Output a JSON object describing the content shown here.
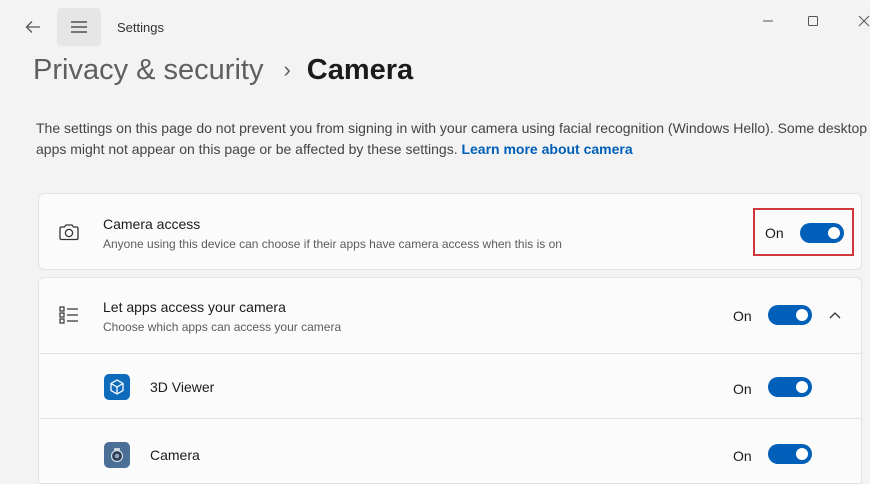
{
  "app": {
    "title": "Settings"
  },
  "breadcrumb": {
    "parent": "Privacy & security",
    "separator": "›",
    "current": "Camera"
  },
  "description": {
    "text": "The settings on this page do not prevent you from signing in with your camera using facial recognition (Windows Hello). Some desktop apps might not appear on this page or be affected by these settings. ",
    "link": "Learn more about camera"
  },
  "camera_access": {
    "title": "Camera access",
    "subtitle": "Anyone using this device can choose if their apps have camera access when this is on",
    "state": "On",
    "icon": "camera-icon"
  },
  "let_apps": {
    "title": "Let apps access your camera",
    "subtitle": "Choose which apps can access your camera",
    "state": "On",
    "icon": "app-list-icon"
  },
  "apps": [
    {
      "name": "3D Viewer",
      "state": "On",
      "icon": "3d-viewer-icon"
    },
    {
      "name": "Camera",
      "state": "On",
      "icon": "camera-app-icon"
    }
  ],
  "colors": {
    "accent": "#005fb8",
    "highlight": "#d0373b"
  }
}
